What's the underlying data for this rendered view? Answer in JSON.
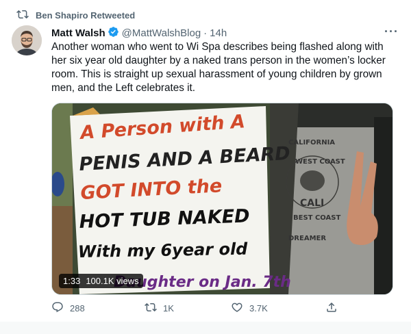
{
  "retweet": {
    "icon": "retweet-icon",
    "label": "Ben Shapiro Retweeted"
  },
  "author": {
    "name": "Matt Walsh",
    "handle": "@MattWalshBlog",
    "separator": "·",
    "time": "14h",
    "verified_color": "#1d9bf0"
  },
  "tweet": {
    "text": "Another woman who went to Wi Spa describes being flashed along with her six year old daughter by a naked trans person in the women’s locker room. This is straight up sexual harassment of young children by grown men, and the Left celebrates it."
  },
  "media": {
    "sign_lines": [
      "A Person with A",
      "PENIS AND A BEARD",
      "GOT INTO the",
      "HOT TUB NAKED",
      "With my 6year old",
      "Daughter on Jan. 7th"
    ],
    "shirt_text": [
      "CALIFORNIA",
      "WEST COAST",
      "CALI",
      "BEST COAST",
      "DREAMER"
    ],
    "duration": "1:33",
    "views": "100.1K views"
  },
  "actions": {
    "reply": {
      "icon": "reply-icon",
      "count": "288"
    },
    "retweet": {
      "icon": "retweet-icon",
      "count": "1K"
    },
    "like": {
      "icon": "heart-icon",
      "count": "3.7K"
    },
    "share": {
      "icon": "share-icon"
    }
  },
  "colors": {
    "text": "#0f1419",
    "muted": "#536471",
    "accent": "#1d9bf0"
  }
}
